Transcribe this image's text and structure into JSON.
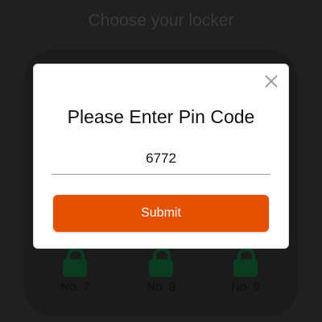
{
  "background": {
    "title": "Choose your locker",
    "lockers": [
      {
        "label": "No. 7",
        "icon": "lock-icon"
      },
      {
        "label": "No. 8",
        "icon": "lock-icon"
      },
      {
        "label": "No. 9",
        "icon": "lock-icon"
      }
    ]
  },
  "dialog": {
    "title": "Please Enter Pin Code",
    "pin_value": "6772",
    "submit_label": "Submit",
    "close_icon": "close-icon"
  },
  "colors": {
    "accent": "#e65100",
    "lock": "#0b3c21",
    "overlay_background": "#202020"
  }
}
